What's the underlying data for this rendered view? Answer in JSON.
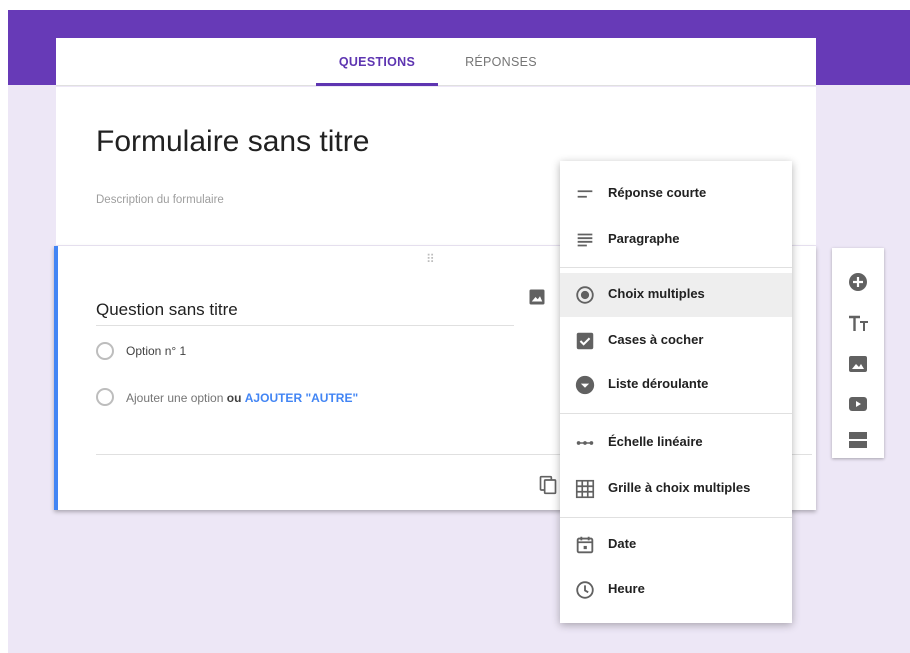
{
  "tabs": {
    "questions": "QUESTIONS",
    "responses": "RÉPONSES"
  },
  "form": {
    "title": "Formulaire sans titre",
    "description": "Description du formulaire"
  },
  "question": {
    "title": "Question sans titre",
    "option1": "Option n° 1",
    "add_option": "Ajouter une option",
    "or": "ou",
    "add_other": "AJOUTER \"AUTRE\""
  },
  "menu": {
    "items": [
      {
        "label": "Réponse courte",
        "icon": "short-text-icon"
      },
      {
        "label": "Paragraphe",
        "icon": "paragraph-icon"
      },
      {
        "label": "Choix multiples",
        "icon": "radio-button-icon",
        "selected": true
      },
      {
        "label": "Cases à cocher",
        "icon": "checkbox-icon"
      },
      {
        "label": "Liste déroulante",
        "icon": "dropdown-icon"
      },
      {
        "label": "Échelle linéaire",
        "icon": "linear-scale-icon"
      },
      {
        "label": "Grille à choix multiples",
        "icon": "grid-icon"
      },
      {
        "label": "Date",
        "icon": "calendar-icon"
      },
      {
        "label": "Heure",
        "icon": "clock-icon"
      }
    ]
  },
  "toolbar": {
    "icons": [
      "add-circle-icon",
      "title-text-icon",
      "image-icon",
      "video-icon",
      "section-icon"
    ]
  },
  "colors": {
    "brand_purple": "#673ab7",
    "tab_active": "#5e35b1",
    "background": "#ede7f6",
    "accent_blue": "#4285f4"
  }
}
